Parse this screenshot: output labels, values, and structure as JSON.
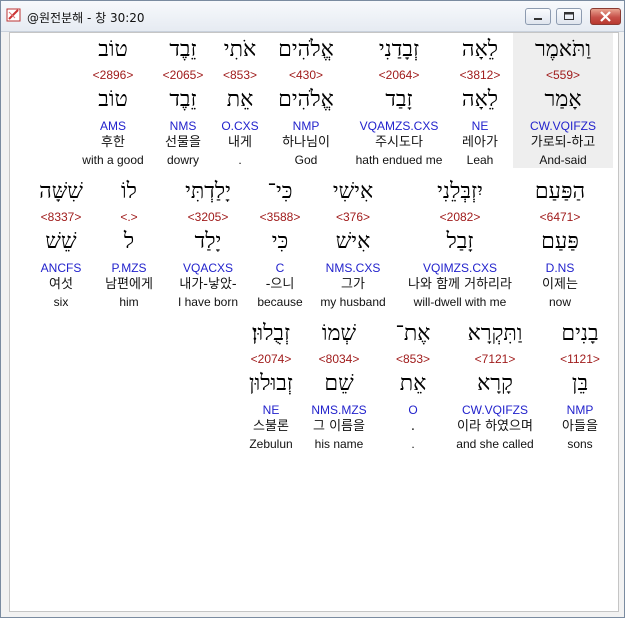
{
  "window": {
    "title": "@원전분해 - 창 30:20"
  },
  "rows": [
    {
      "words": [
        {
          "heb": "וַתֹּאמֶר",
          "strong": "<559>",
          "root": "אָמַר",
          "gram": "CW.VQIFZS",
          "kor": "가로되-하고",
          "eng": "And-said",
          "highlight": true
        },
        {
          "heb": "לֵאָה",
          "strong": "<3812>",
          "root": "לֵאָה",
          "gram": "NE",
          "kor": "레아가",
          "eng": "Leah"
        },
        {
          "heb": "זְבָדַנִי",
          "strong": "<2064>",
          "root": "זָבַד",
          "gram": "VQAMZS.CXS",
          "kor": "주시도다",
          "eng": "hath endued me"
        },
        {
          "heb": "אֱלֹהִים",
          "strong": "<430>",
          "root": "אֱלֹהִים",
          "gram": "NMP",
          "kor": "하나님이",
          "eng": "God"
        },
        {
          "heb": "אֹתִי",
          "strong": "<853>",
          "root": "אֵת",
          "gram": "O.CXS",
          "kor": "내게",
          "eng": "."
        },
        {
          "heb": "זֵבֶד",
          "strong": "<2065>",
          "root": "זֵבֶד",
          "gram": "NMS",
          "kor": "선물을",
          "eng": "dowry"
        },
        {
          "heb": "טוֹב",
          "strong": "<2896>",
          "root": "טוֹב",
          "gram": "AMS",
          "kor": "후한",
          "eng": "with a good"
        }
      ]
    },
    {
      "words": [
        {
          "heb": "הַפַּעַם",
          "strong": "<6471>",
          "root": "פַּעַם",
          "gram": "D.NS",
          "kor": "이제는",
          "eng": "now"
        },
        {
          "heb": "יִזְבְּלֵנִי",
          "strong": "<2082>",
          "root": "זָבַל",
          "gram": "VQIMZS.CXS",
          "kor": "나와 함께 거하리라",
          "eng": "will-dwell with me"
        },
        {
          "heb": "אִישִׁי",
          "strong": "<376>",
          "root": "אִישׁ",
          "gram": "NMS.CXS",
          "kor": "그가",
          "eng": "my husband"
        },
        {
          "heb": "כִּי־",
          "strong": "<3588>",
          "root": "כִּי",
          "gram": "C",
          "kor": "-으니",
          "eng": "because"
        },
        {
          "heb": "יָלַדְתִּי",
          "strong": "<3205>",
          "root": "יָלַד",
          "gram": "VQACXS",
          "kor": "내가-낳았-",
          "eng": "I have born"
        },
        {
          "heb": "לוֹ",
          "strong": "<.>",
          "root": "ל",
          "gram": "P.MZS",
          "kor": "남편에게",
          "eng": "him"
        },
        {
          "heb": "שִׁשָּׁה",
          "strong": "<8337>",
          "root": "שֵׁשׁ",
          "gram": "ANCFS",
          "kor": "여섯",
          "eng": "six"
        }
      ]
    },
    {
      "words": [
        {
          "heb": "בָנִים",
          "strong": "<1121>",
          "root": "בֵּן",
          "gram": "NMP",
          "kor": "아들을",
          "eng": "sons"
        },
        {
          "heb": "וַתִּקְרָא",
          "strong": "<7121>",
          "root": "קָרָא",
          "gram": "CW.VQIFZS",
          "kor": "이라 하였으며",
          "eng": "and she called"
        },
        {
          "heb": "אֶת־",
          "strong": "<853>",
          "root": "אֵת",
          "gram": "O",
          "kor": ".",
          "eng": "."
        },
        {
          "heb": "שְׁמוֹ",
          "strong": "<8034>",
          "root": "שֵׁם",
          "gram": "NMS.MZS",
          "kor": "그 이름을",
          "eng": "his name"
        },
        {
          "heb": "זְבֻלוּן׃",
          "strong": "<2074>",
          "root": "זְבוּלוּן",
          "gram": "NE",
          "kor": "스불론",
          "eng": "Zebulun"
        }
      ]
    }
  ]
}
